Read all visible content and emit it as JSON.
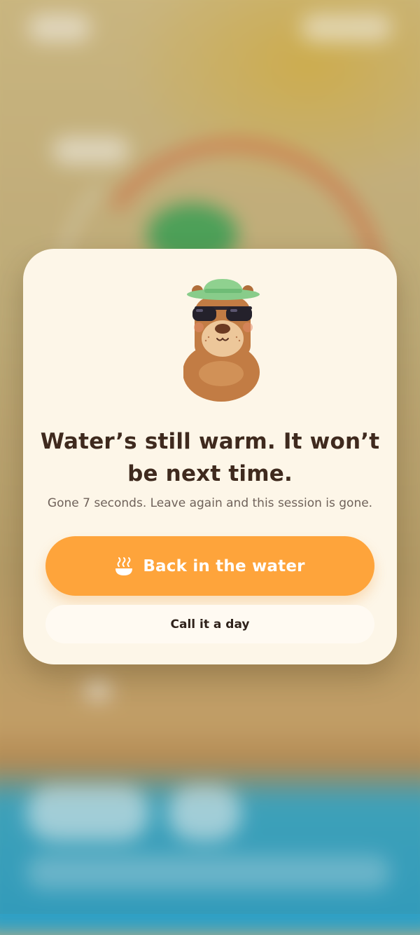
{
  "modal": {
    "mascot_icon": "bear-with-hat-and-sunglasses-icon",
    "headline": "Water’s still warm. It won’t be next time.",
    "subtext": "Gone 7 seconds. Leave again and this session is gone.",
    "primary_button": {
      "icon": "hot-spring-icon",
      "label": "Back in the water"
    },
    "secondary_button": {
      "label": "Call it a day"
    }
  },
  "colors": {
    "modal_bg": "#fdf6e8",
    "primary": "#fea43b",
    "text_dark": "#3f2a1e",
    "text_muted": "#6f625a"
  }
}
